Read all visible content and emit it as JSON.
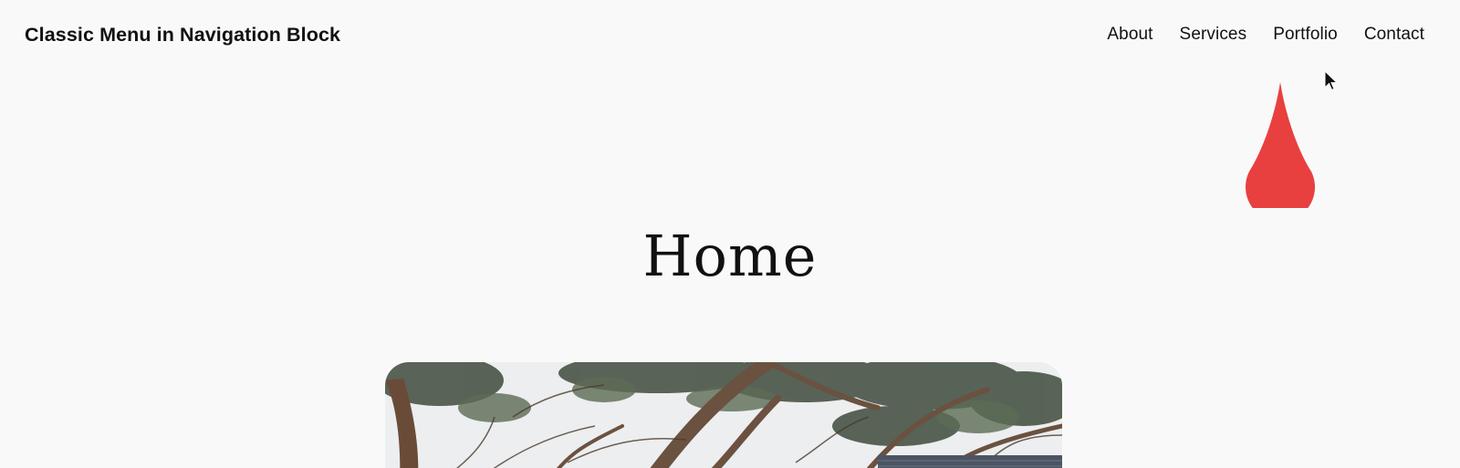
{
  "header": {
    "site_title": "Classic Menu in Navigation Block",
    "nav": [
      {
        "label": "About"
      },
      {
        "label": "Services"
      },
      {
        "label": "Portfolio"
      },
      {
        "label": "Contact"
      }
    ]
  },
  "main": {
    "page_title": "Home",
    "hero_image": {
      "subject": "tree-branches-and-roof"
    }
  },
  "overlay": {
    "cursor_icon": "mouse-pointer-icon",
    "drop_icon": "red-drop-icon",
    "drop_color": "#e8403f"
  },
  "colors": {
    "background": "#f9f9f9",
    "text": "#111111"
  }
}
